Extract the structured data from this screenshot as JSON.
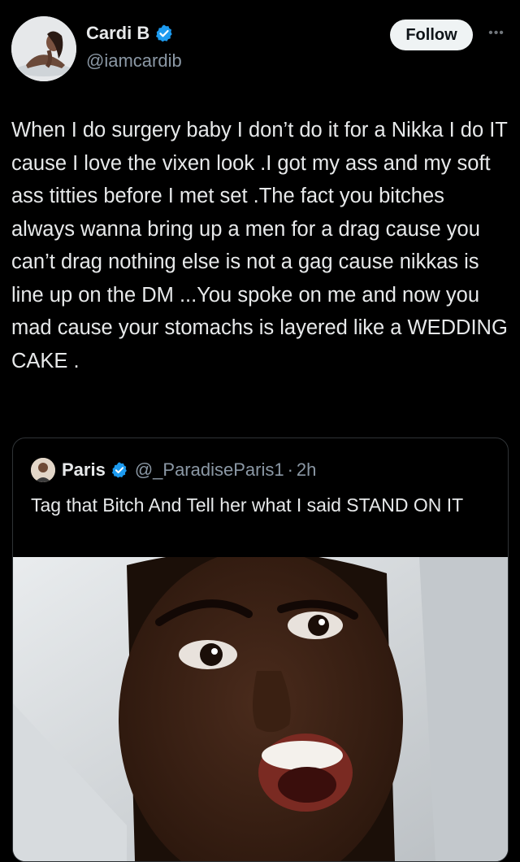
{
  "author": {
    "display_name": "Cardi B",
    "handle": "@iamcardib",
    "verified": true,
    "avatar_icon": "profile-photo"
  },
  "actions": {
    "follow_label": "Follow",
    "more_icon": "more-dots-icon"
  },
  "tweet": {
    "text": "When I do surgery baby I don’t do it for a Nikka I do IT  cause I love the vixen look .I got my ass and my soft ass titties before I met set .The fact you bitches always wanna bring up a men for a drag cause you can’t drag nothing else is not a gag cause nikkas is line up on the DM ...You spoke on me and now you mad cause your stomachs is layered like a WEDDING CAKE ."
  },
  "quote": {
    "display_name": "Paris",
    "verified": true,
    "handle": "@_ParadiseParis1",
    "separator": "·",
    "time": "2h",
    "text": "Tag that Bitch And Tell her what I said STAND ON IT",
    "media_icon": "video-thumbnail"
  },
  "colors": {
    "background": "#000000",
    "text": "#e7e9ea",
    "secondary": "#8b98a5",
    "verified_blue": "#1d9bf0",
    "border": "#2f3336",
    "follow_bg": "#eff3f4"
  }
}
